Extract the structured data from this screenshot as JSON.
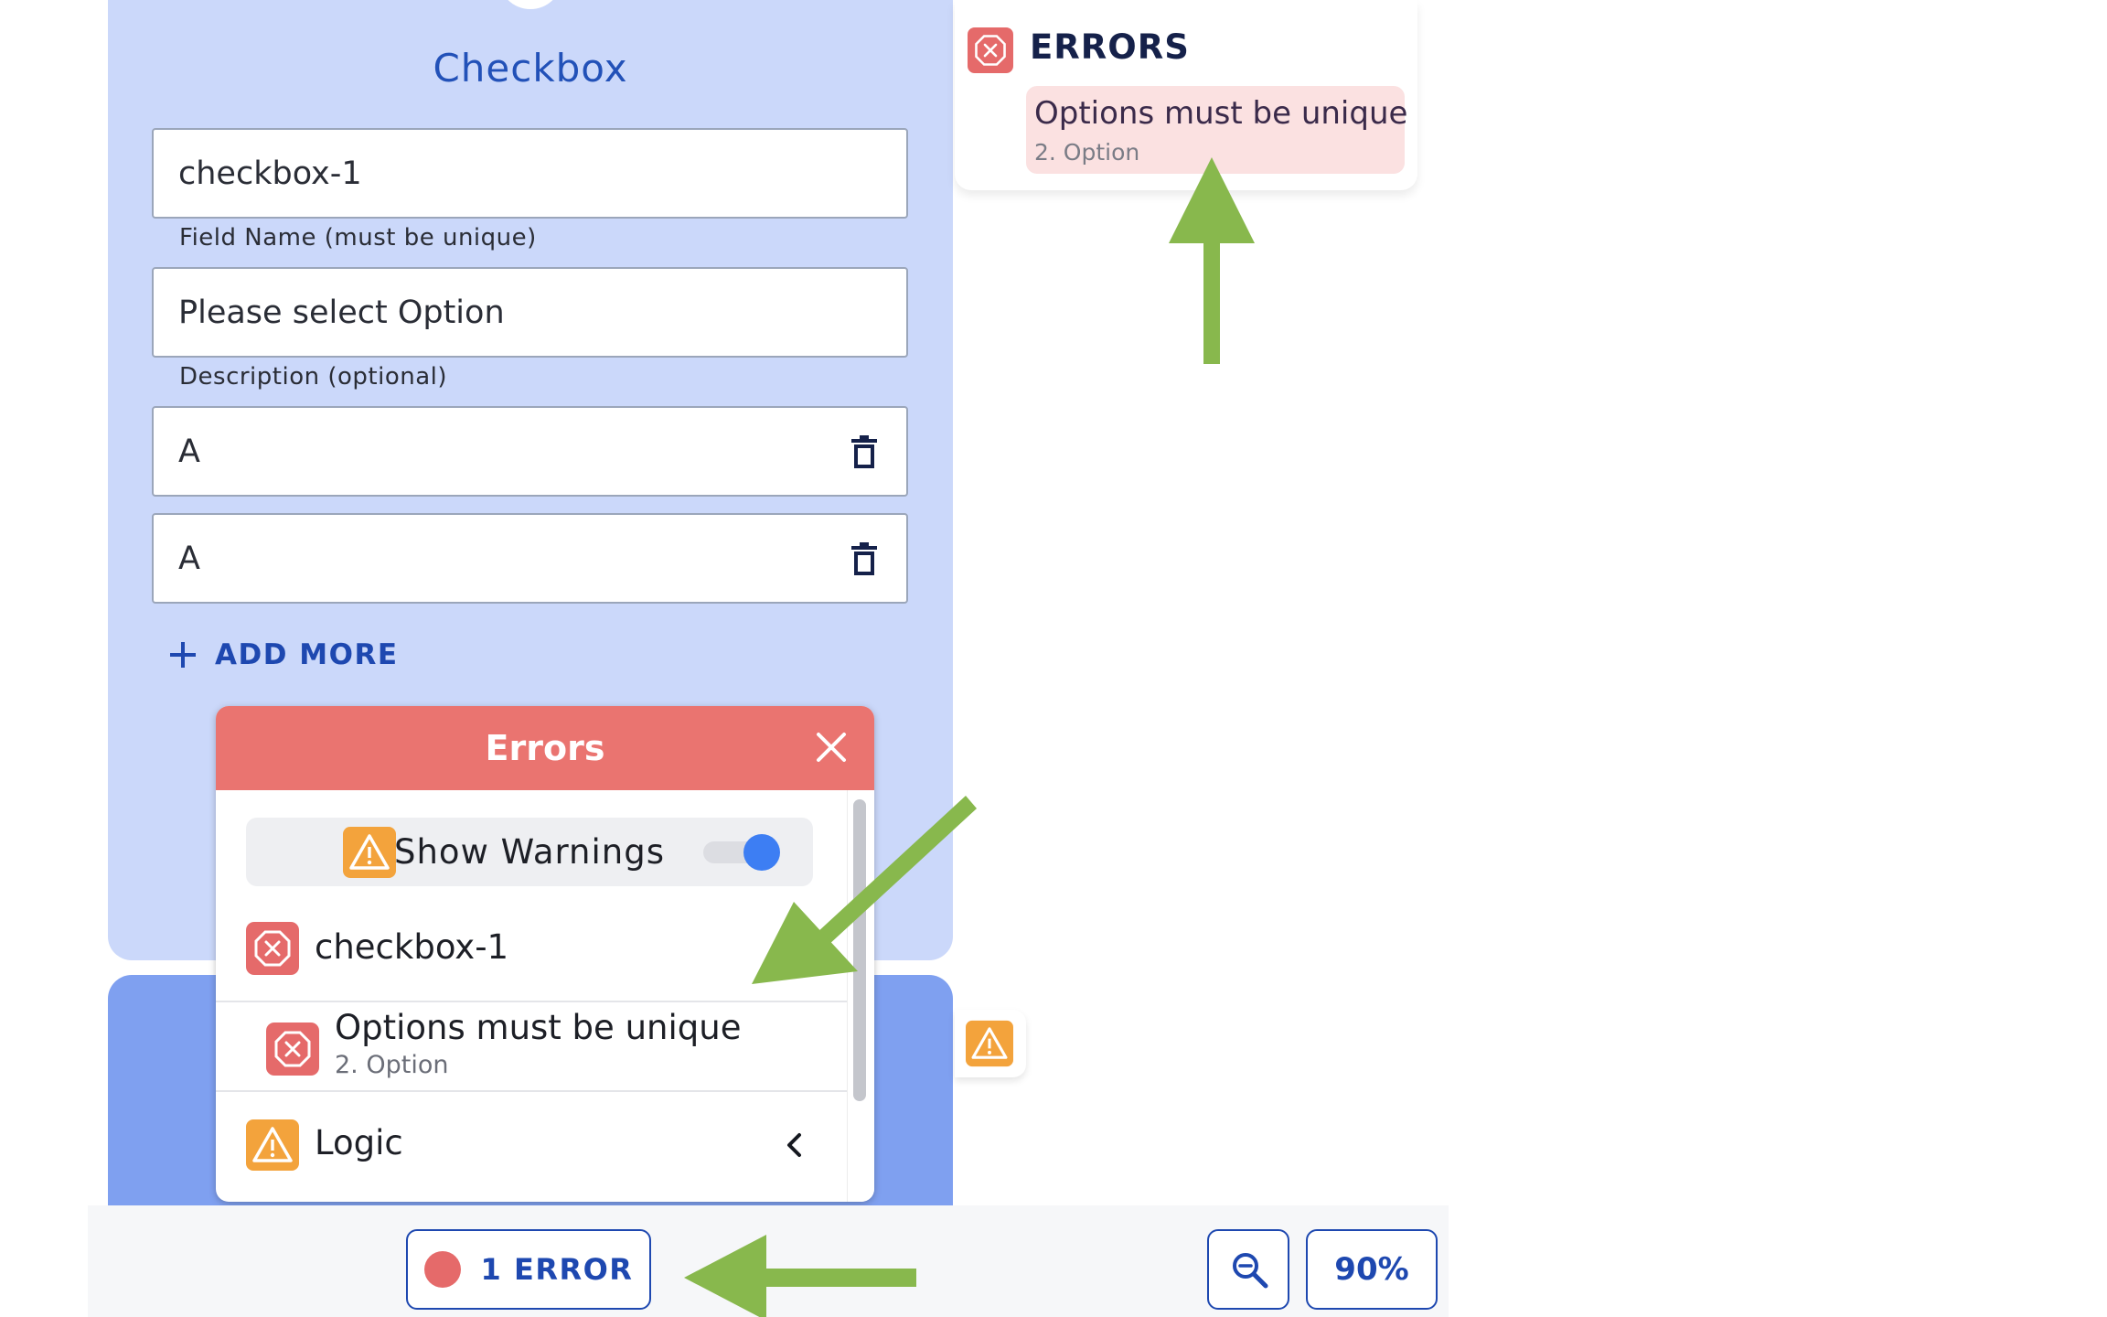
{
  "card": {
    "title": "Checkbox",
    "field_name": {
      "value": "checkbox-1",
      "helper": "Field Name (must be unique)"
    },
    "description": {
      "value": "Please select Option",
      "helper": "Description (optional)"
    },
    "options": [
      {
        "value": "A"
      },
      {
        "value": "A"
      }
    ],
    "add_more_label": "ADD MORE"
  },
  "errors_dialog": {
    "title": "Errors",
    "show_warnings_label": "Show Warnings",
    "show_warnings_on": true,
    "group": "checkbox-1",
    "error": {
      "message": "Options must be unique",
      "detail": "2. Option"
    },
    "logic_label": "Logic"
  },
  "errors_panel": {
    "title": "ERRORS",
    "item": {
      "message": "Options must be unique",
      "detail": "2. Option"
    }
  },
  "toolbar": {
    "error_count_label": "1 ERROR",
    "zoom_level": "90%"
  },
  "colors": {
    "accent": "#1e48b0",
    "error": "#ea7470",
    "warning": "#f3a33c",
    "annotation_arrow": "#88b84d"
  },
  "icons": [
    "trash-icon",
    "plus-icon",
    "close-icon",
    "warning-icon",
    "error-icon",
    "chevron-left-icon",
    "zoom-icon"
  ]
}
